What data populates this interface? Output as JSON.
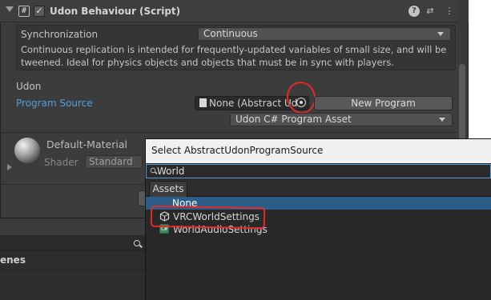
{
  "component": {
    "title": "Udon Behaviour (Script)",
    "script_icon": "#",
    "enabled_check": "✓",
    "help_icon": "?",
    "presets_icon": "⇄",
    "menu_icon": "⋮"
  },
  "sync": {
    "label": "Synchronization",
    "value": "Continuous",
    "description": "Continuous replication is intended for frequently-updated variables of small size, and will be tweened. Ideal for physics objects and objects that must be in sync with players."
  },
  "udon": {
    "section_label": "Udon",
    "program_source_label": "Program Source",
    "program_source_value": "None (Abstract Udo",
    "new_program_label": "New Program",
    "asset_type": "Udon C# Program Asset"
  },
  "material": {
    "name": "Default-Material",
    "shader_label": "Shader",
    "shader_value": "Standard"
  },
  "bottom_panel": {
    "section_label": "enes"
  },
  "picker": {
    "title": "Select AbstractUdonProgramSource",
    "search_value": "World",
    "tab_label": "Assets",
    "items": [
      {
        "label": "None",
        "icon": "none",
        "selected": true
      },
      {
        "label": "VRCWorldSettings",
        "icon": "udon-program-icon",
        "selected": false
      },
      {
        "label": "WorldAudioSettings",
        "icon": "csharp-script-icon",
        "selected": false
      }
    ],
    "audio_icon_glyph": "C#"
  },
  "colors": {
    "annotation_red": "#e32a2a",
    "link_blue": "#4f9fe0",
    "selection_blue": "#2c5d87"
  }
}
